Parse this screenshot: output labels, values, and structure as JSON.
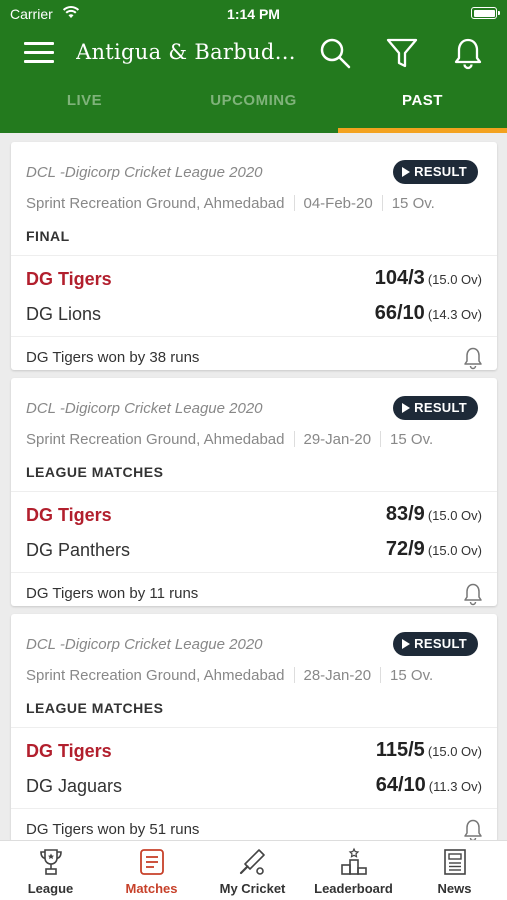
{
  "status_bar": {
    "carrier": "Carrier",
    "time": "1:14 PM"
  },
  "header": {
    "title": "Antigua & Barbuda..."
  },
  "tabs": [
    {
      "label": "LIVE",
      "active": false
    },
    {
      "label": "UPCOMING",
      "active": false
    },
    {
      "label": "PAST",
      "active": true
    }
  ],
  "colors": {
    "header_bg": "#237a1e",
    "tab_indicator": "#f3a21f",
    "winner_text": "#b21f2d",
    "badge_bg": "#1e2a38",
    "active_nav": "#c7412a"
  },
  "matches": [
    {
      "league": "DCL -Digicorp Cricket League 2020",
      "badge": "RESULT",
      "venue": "Sprint Recreation Ground, Ahmedabad",
      "date": "04-Feb-20",
      "format": "15 Ov.",
      "stage": "FINAL",
      "team1": {
        "name": "DG Tigers",
        "score": "104/3",
        "overs": "(15.0 Ov)"
      },
      "team2": {
        "name": "DG Lions",
        "score": "66/10",
        "overs": "(14.3 Ov)"
      },
      "result": "DG Tigers won by 38 runs"
    },
    {
      "league": "DCL -Digicorp Cricket League 2020",
      "badge": "RESULT",
      "venue": "Sprint Recreation Ground, Ahmedabad",
      "date": "29-Jan-20",
      "format": "15 Ov.",
      "stage": "LEAGUE MATCHES",
      "team1": {
        "name": "DG Tigers",
        "score": "83/9",
        "overs": "(15.0 Ov)"
      },
      "team2": {
        "name": "DG Panthers",
        "score": "72/9",
        "overs": "(15.0 Ov)"
      },
      "result": "DG Tigers won by 11 runs"
    },
    {
      "league": "DCL -Digicorp Cricket League 2020",
      "badge": "RESULT",
      "venue": "Sprint Recreation Ground, Ahmedabad",
      "date": "28-Jan-20",
      "format": "15 Ov.",
      "stage": "LEAGUE MATCHES",
      "team1": {
        "name": "DG Tigers",
        "score": "115/5",
        "overs": "(15.0 Ov)"
      },
      "team2": {
        "name": "DG Jaguars",
        "score": "64/10",
        "overs": "(11.3 Ov)"
      },
      "result": "DG Tigers won by 51 runs"
    }
  ],
  "bottom_nav": [
    {
      "label": "League",
      "icon": "trophy-icon",
      "active": false
    },
    {
      "label": "Matches",
      "icon": "matches-icon",
      "active": true
    },
    {
      "label": "My Cricket",
      "icon": "cricket-bat-icon",
      "active": false
    },
    {
      "label": "Leaderboard",
      "icon": "podium-icon",
      "active": false
    },
    {
      "label": "News",
      "icon": "newspaper-icon",
      "active": false
    }
  ]
}
